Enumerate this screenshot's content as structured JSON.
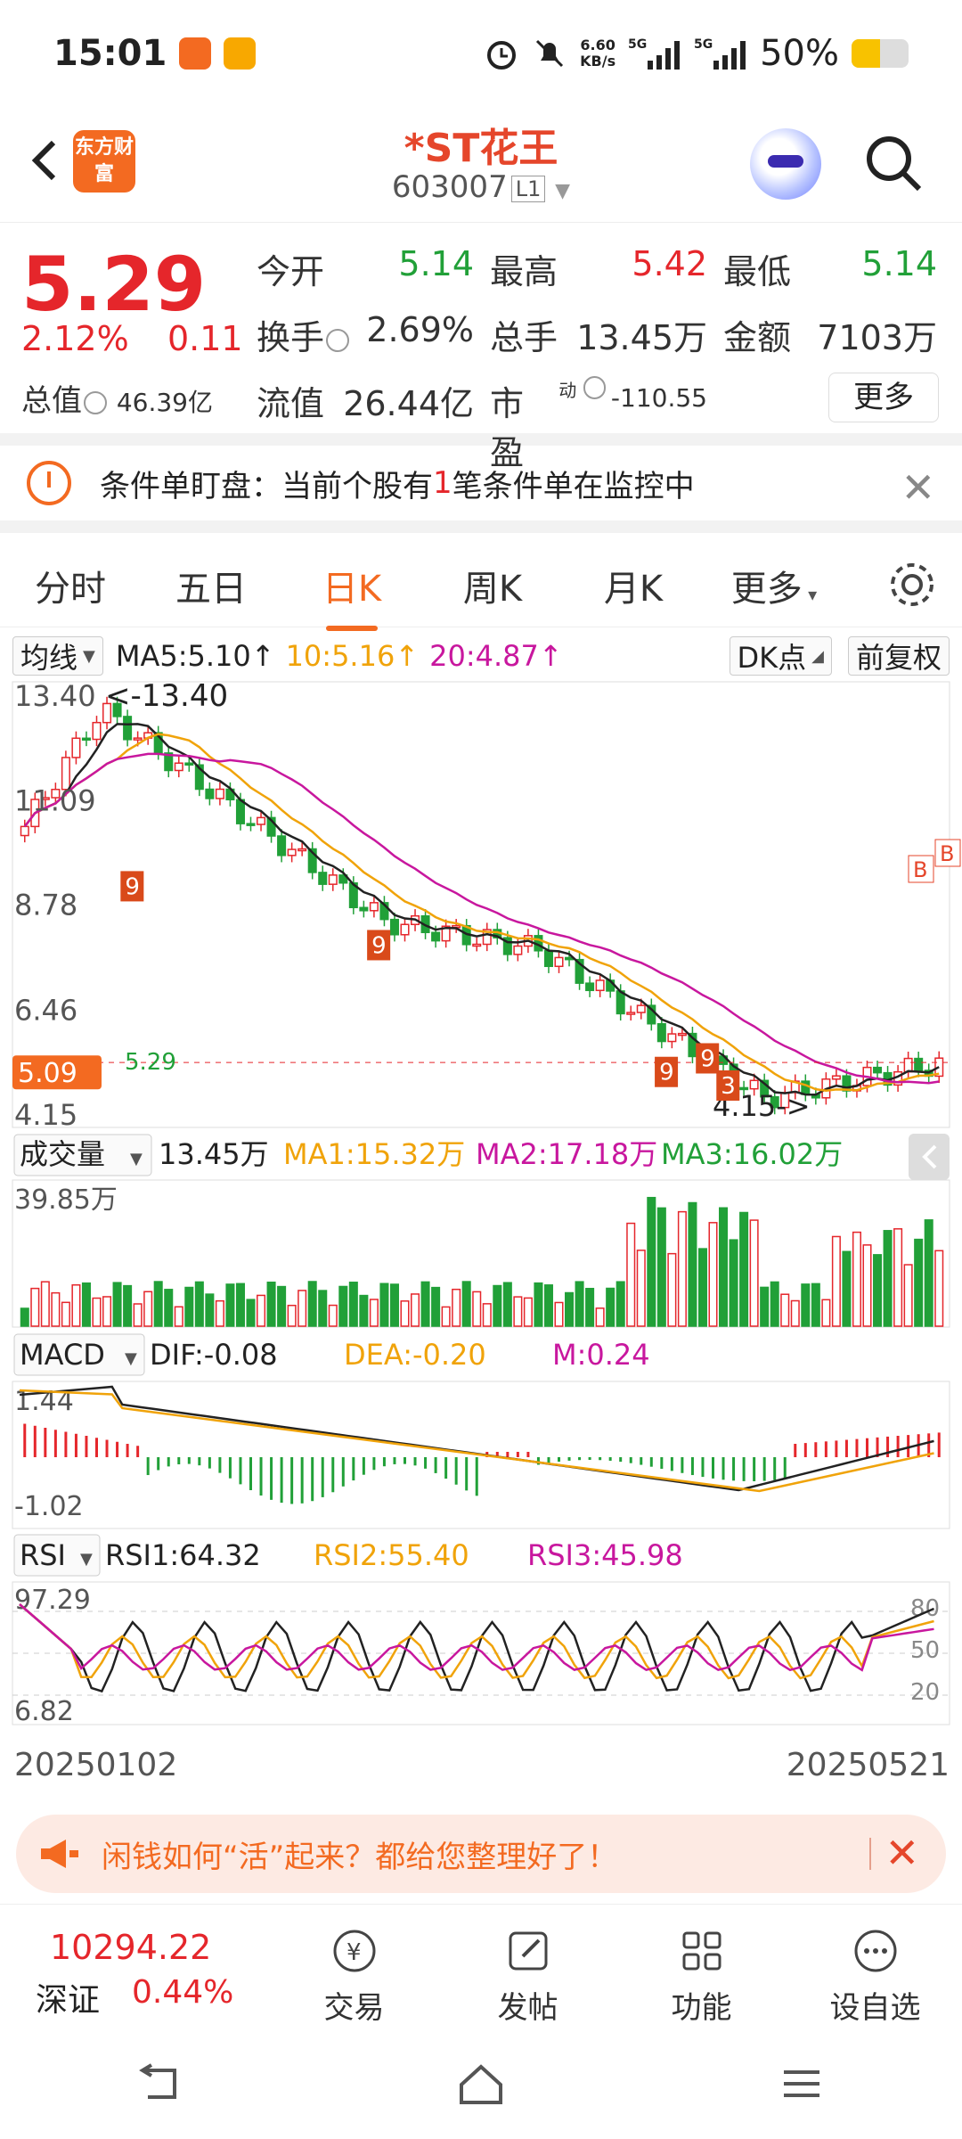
{
  "status": {
    "time": "15:01",
    "net_speed_value": "6.60",
    "net_speed_unit": "KB/s",
    "sig1": "5G",
    "sig2": "5G",
    "battery": "50%"
  },
  "header": {
    "logo_text": "东方财富",
    "stock_name": "*ST花王",
    "stock_code": "603007",
    "level": "L1"
  },
  "quote": {
    "price": "5.29",
    "change_pct": "2.12%",
    "change": "0.11",
    "total_cap_label": "总值",
    "total_cap": "46.39亿",
    "rows": [
      [
        {
          "label": "今开",
          "value": "5.14",
          "color": "green"
        },
        {
          "label": "最高",
          "value": "5.42",
          "color": "red"
        },
        {
          "label": "最低",
          "value": "5.14",
          "color": "green"
        }
      ],
      [
        {
          "label": "换手",
          "value": "2.69%",
          "color": "black"
        },
        {
          "label": "总手",
          "value": "13.45万",
          "color": "black"
        },
        {
          "label": "金额",
          "value": "7103万",
          "color": "black"
        }
      ]
    ],
    "float_cap_label": "流值",
    "float_cap": "26.44亿",
    "pe_label": "市盈",
    "pe_sup": "动",
    "pe": "-110.55",
    "more": "更多"
  },
  "alert": {
    "text_before": "条件单盯盘：当前个股有",
    "count": "1",
    "text_after": "笔条件单在监控中"
  },
  "tabs": [
    "分时",
    "五日",
    "日K",
    "周K",
    "月K",
    "更多"
  ],
  "active_tab": "日K",
  "ma_row": {
    "select": "均线",
    "ma5": "MA5:5.10",
    "ma10": "10:5.16",
    "ma20": "20:4.87",
    "dk": "DK点",
    "fq": "前复权"
  },
  "chart_data": {
    "type": "candlestick",
    "x_start": "20250102",
    "x_end": "20250521",
    "price_ticks": [
      "13.40",
      "11.09",
      "8.78",
      "6.46",
      "4.15"
    ],
    "ylim": [
      4.15,
      13.4
    ],
    "high_label": "<-13.40",
    "low_label": "4.15->",
    "current_price_tag": "5.09",
    "limit_label": "5.29",
    "td_markers": [
      "9",
      "9",
      "9",
      "9",
      "3",
      "B",
      "B"
    ],
    "volume": {
      "select": "成交量",
      "value": "13.45万",
      "ma1": "MA1:15.32万",
      "ma2": "MA2:17.18万",
      "ma3": "MA3:16.02万",
      "max_label": "39.85万"
    },
    "macd": {
      "select": "MACD",
      "dif": "DIF:-0.08",
      "dea": "DEA:-0.20",
      "m": "M:0.24",
      "top": "1.44",
      "bottom": "-1.02"
    },
    "rsi": {
      "select": "RSI",
      "rsi1": "RSI1:64.32",
      "rsi2": "RSI2:55.40",
      "rsi3": "RSI3:45.98",
      "top": "97.29",
      "bottom": "6.82",
      "ref_high": "80",
      "ref_mid": "50",
      "ref_low": "20"
    }
  },
  "banner": {
    "text": "闲钱如何“活”起来？都给您整理好了！"
  },
  "bottom_nav": {
    "index_value": "10294.22",
    "index_name": "深证",
    "index_pct": "0.44%",
    "items": [
      "交易",
      "发帖",
      "功能",
      "设自选"
    ]
  }
}
